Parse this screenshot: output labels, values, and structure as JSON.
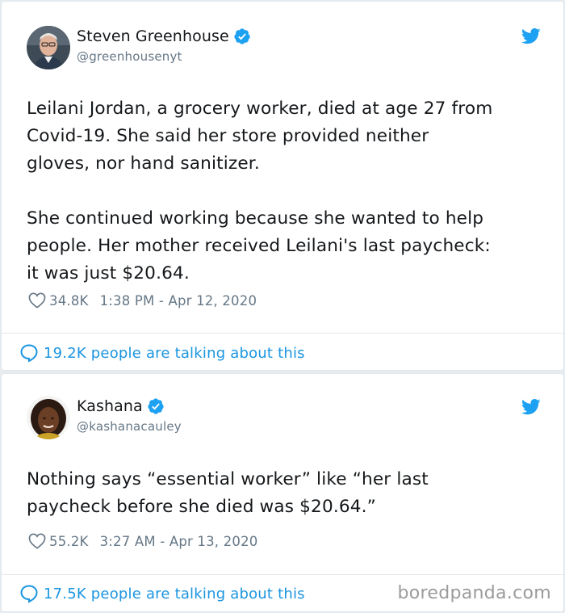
{
  "tweets": [
    {
      "author": {
        "name": "Steven Greenhouse",
        "handle": "@greenhousenyt",
        "verified": true
      },
      "text": [
        "Leilani Jordan, a grocery worker, died at age 27 from\nCovid-19. She said her store provided neither\ngloves, nor hand sanitizer.",
        "She continued working because she wanted to help\npeople. Her mother received Leilani's last paycheck:\nit was just $20.64."
      ],
      "likes": "34.8K",
      "timestamp": "1:38 PM - Apr 12, 2020",
      "talking": "19.2K people are talking about this"
    },
    {
      "author": {
        "name": "Kashana",
        "handle": "@kashanacauley",
        "verified": true
      },
      "text": [
        "Nothing says “essential worker” like “her last\npaycheck before she died was $20.64.”"
      ],
      "likes": "55.2K",
      "timestamp": "3:27 AM - Apr 13, 2020",
      "talking": "17.5K people are talking about this"
    }
  ],
  "watermark": "boredpanda.com",
  "icons": [
    "verified-icon",
    "twitter-bird-icon",
    "heart-icon",
    "speech-bubble-icon"
  ],
  "colors": {
    "accent": "#1da1f2",
    "link": "#1b95e0",
    "muted": "#657786",
    "text": "#14171a",
    "background": "#e6ecf0"
  }
}
